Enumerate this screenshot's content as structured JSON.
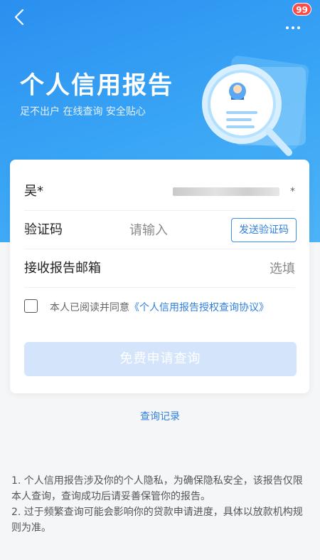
{
  "header": {
    "back_icon": "chevron-left-icon",
    "more_icon": "more-dots-icon",
    "badge_count": "99"
  },
  "hero": {
    "title": "个人信用报告",
    "subtitle": "足不出户 在线查询 安全贴心",
    "illustration_icon": "credit-report-magnifier-icon"
  },
  "form": {
    "name_label": "吴*",
    "name_suffix": "*",
    "code_label": "验证码",
    "code_placeholder": "请输入",
    "send_code_label": "发送验证码",
    "email_label": "接收报告邮箱",
    "email_placeholder": "选填",
    "agree_prefix": "本人已阅读并同意",
    "agree_link": "《个人信用报告授权查询协议》",
    "submit_label": "免费申请查询"
  },
  "history_link": "查询记录",
  "notes": [
    "1. 个人信用报告涉及你的个人隐私，为确保隐私安全，该报告仅限本人查询，查询成功后请妥善保管你的报告。",
    "2. 过于频繁查询可能会影响你的贷款申请进度，具体以放款机构规则为准。"
  ],
  "colors": {
    "brand_blue": "#2f7fe0",
    "hero_gradient_start": "#2a8ff0",
    "submit_disabled": "#d4e5fb",
    "badge_red": "#ff4a4a"
  }
}
